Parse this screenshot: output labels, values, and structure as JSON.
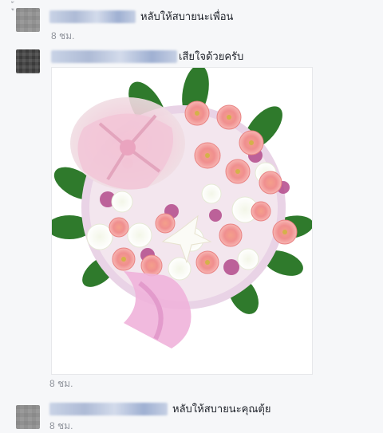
{
  "comments": [
    {
      "name": "",
      "text": "หลับให้สบายนะเพื่อน",
      "time": "8 ชม."
    },
    {
      "name": "",
      "text": "เสียใจด้วยครับ",
      "time": "8 ชม."
    },
    {
      "name": "",
      "text": "หลับให้สบายนะคุณตุ้ย",
      "time": "8 ชม."
    }
  ],
  "top_fragment": "ู้",
  "image": {
    "subject": "pink-and-white-funeral-flower-wreath"
  },
  "colors": {
    "bg": "#f6f7f9",
    "meta": "#90949c",
    "name_blur": "#b3c1dc"
  },
  "icons": [
    "avatar",
    "wreath-image"
  ]
}
